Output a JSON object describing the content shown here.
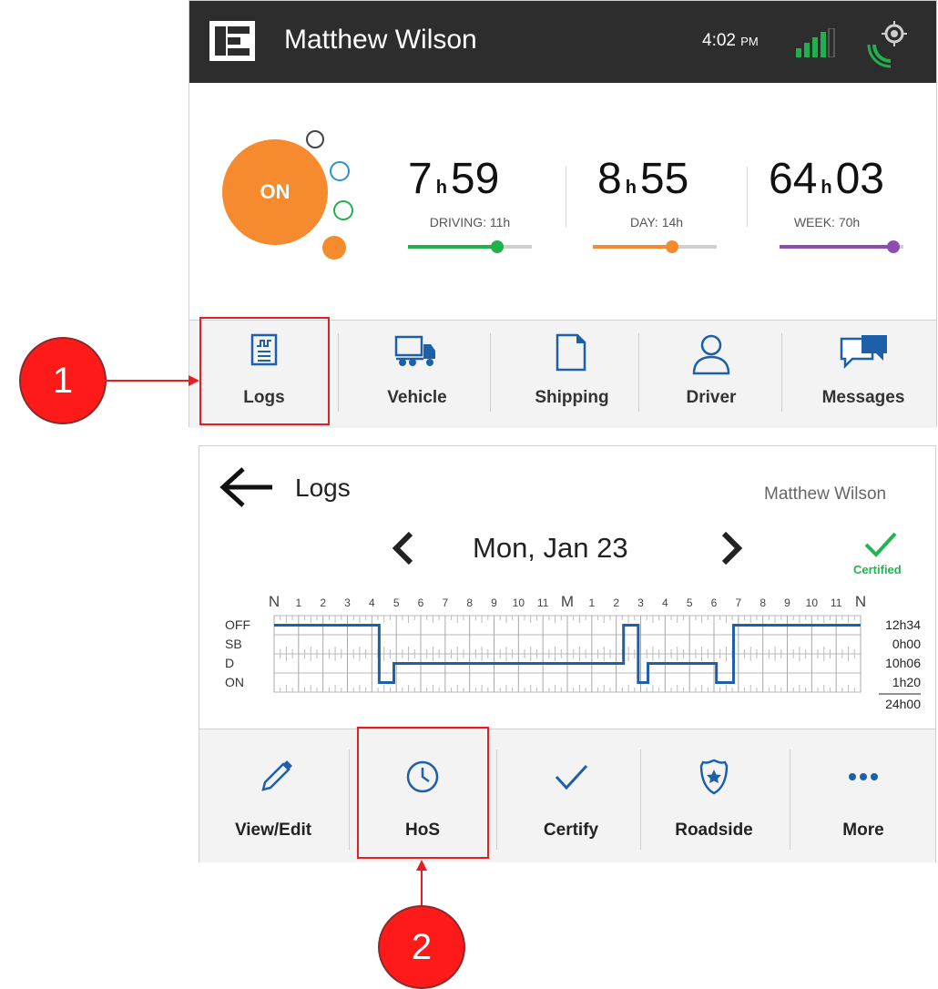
{
  "header": {
    "driver_name": "Matthew Wilson",
    "time": "4:02",
    "ampm": "PM",
    "status": "ON",
    "colors": {
      "topbar": "#2d2d2d",
      "on_status": "#f58a2e"
    }
  },
  "clocks": [
    {
      "hours": "7",
      "unit": "h",
      "minutes": "59",
      "label": "DRIVING: 11h",
      "progress": 0.72,
      "color": "#21b04b"
    },
    {
      "hours": "8",
      "unit": "h",
      "minutes": "55",
      "label": "DAY: 14h",
      "progress": 0.64,
      "color": "#f58a2e"
    },
    {
      "hours": "64",
      "unit": "h",
      "minutes": "03",
      "label": "WEEK: 70h",
      "progress": 0.92,
      "color": "#8e4bb3"
    }
  ],
  "main_nav": [
    {
      "label": "Logs",
      "icon": "logs-icon"
    },
    {
      "label": "Vehicle",
      "icon": "truck-icon"
    },
    {
      "label": "Shipping",
      "icon": "document-icon"
    },
    {
      "label": "Driver",
      "icon": "driver-icon"
    },
    {
      "label": "Messages",
      "icon": "messages-icon"
    }
  ],
  "callouts": [
    "1",
    "2"
  ],
  "logs": {
    "title": "Logs",
    "user": "Matthew Wilson",
    "date": "Mon, Jan 23",
    "certified": "Certified"
  },
  "chart_data": {
    "type": "line",
    "x_ticks": [
      "N",
      "1",
      "2",
      "3",
      "4",
      "5",
      "6",
      "7",
      "8",
      "9",
      "10",
      "11",
      "M",
      "1",
      "2",
      "3",
      "4",
      "5",
      "6",
      "7",
      "8",
      "9",
      "10",
      "11",
      "N"
    ],
    "rows": [
      "OFF",
      "SB",
      "D",
      "ON"
    ],
    "totals": [
      "12h34",
      "0h00",
      "10h06",
      "1h20"
    ],
    "grand_total": "24h00",
    "segments": [
      {
        "start": 0.0,
        "end": 4.3,
        "status": "OFF"
      },
      {
        "start": 4.3,
        "end": 4.9,
        "status": "ON"
      },
      {
        "start": 4.9,
        "end": 14.3,
        "status": "D"
      },
      {
        "start": 14.3,
        "end": 14.9,
        "status": "OFF"
      },
      {
        "start": 14.9,
        "end": 15.3,
        "status": "ON"
      },
      {
        "start": 15.3,
        "end": 18.1,
        "status": "D"
      },
      {
        "start": 18.1,
        "end": 18.8,
        "status": "ON"
      },
      {
        "start": 18.8,
        "end": 24.0,
        "status": "OFF"
      }
    ],
    "line_color": "#1d5fa8"
  },
  "bottom_nav": [
    {
      "label": "View/Edit",
      "icon": "pencil-icon"
    },
    {
      "label": "HoS",
      "icon": "clock-icon"
    },
    {
      "label": "Certify",
      "icon": "checkmark-icon"
    },
    {
      "label": "Roadside",
      "icon": "police-badge-icon"
    },
    {
      "label": "More",
      "icon": "more-icon"
    }
  ]
}
